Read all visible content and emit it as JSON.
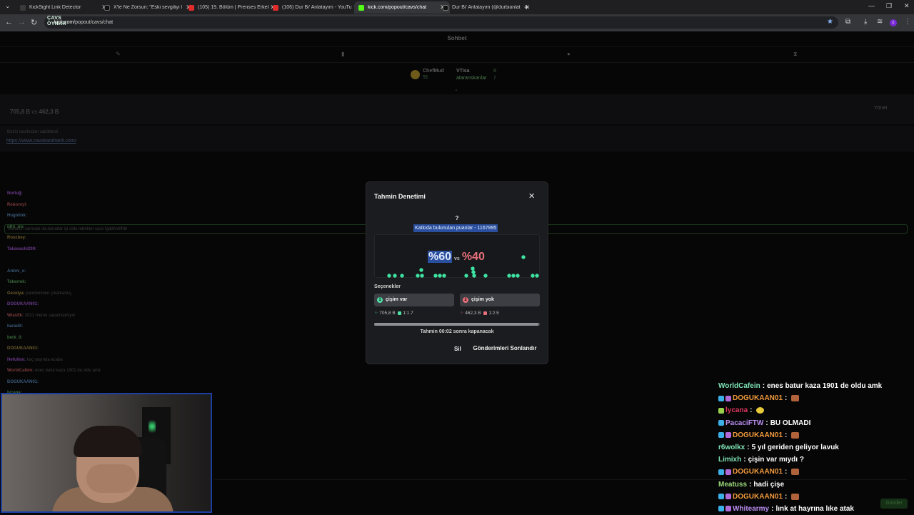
{
  "browser": {
    "tabs": [
      {
        "title": "KickSight Link Detector",
        "color": "#3a3a3a"
      },
      {
        "title": "X'te Ne Zorsun: \"Eski sevgiliyi l",
        "color": "#111111"
      },
      {
        "title": "(105) 19. Bölüm | Prenses Erkek",
        "color": "#e02b2b"
      },
      {
        "title": "(106) Dur Bi' Anlatayım - YouTu",
        "color": "#e02b2b"
      },
      {
        "title": "kick.com/popout/cavs/chat",
        "color": "#53fc18"
      },
      {
        "title": "Dur Bi' Anlatayım (@durbianlat",
        "color": "#111111"
      }
    ],
    "url_host": "kick.com",
    "url_path": "/popout/cavs/chat",
    "profile_initial": "c",
    "overlay_logo": "ÇAVS OYNAR"
  },
  "page": {
    "title": "Sohbet",
    "leaderboard": {
      "first_name": "ChefMud",
      "first_value": "91",
      "second_name": "VTisa",
      "second_value": "8",
      "third_name": "ataranskanlar",
      "third_value": "7"
    },
    "prediction_summary": {
      "left": "705,8 B",
      "vs": "vs",
      "right": "462,3 B",
      "manage": "Yönet"
    },
    "pinned": {
      "by": "Botrix tarafından sabitlendi",
      "link": "https://www.cavskarahanli.com/"
    },
    "left_chat": [
      {
        "user": "Nurtuğ:",
        "text": ""
      },
      {
        "user": "Rebornyl:",
        "text": ""
      },
      {
        "user": "Hugolink:",
        "text": ""
      },
      {
        "user": "nftn_nn:",
        "text": ""
      },
      {
        "user": "Roozbey:",
        "text": ""
      },
      {
        "user": "Takanachi209:",
        "text": ""
      },
      {
        "user": "",
        "text": ""
      },
      {
        "user": "Ardov_x:",
        "text": ""
      },
      {
        "user": "Tekerrek:",
        "text": ""
      },
      {
        "user": "Gezelya:",
        "text": "pandemiden çıkamamış"
      },
      {
        "user": "DOGUKAAN01:",
        "text": ""
      },
      {
        "user": "Wlasfik:",
        "text": "2021 meme sapamiamıyın"
      },
      {
        "user": "haradit:",
        "text": ""
      },
      {
        "user": "berk_0:",
        "text": ""
      },
      {
        "user": "DOGUKAAN01:",
        "text": ""
      },
      {
        "user": "Hefulion:",
        "text": "kaç yaşında acaba"
      },
      {
        "user": "WorldCafein:",
        "text": "enes batur kaza 1901 de oldu amk"
      },
      {
        "user": "DOGUKAAN01:",
        "text": ""
      },
      {
        "user": "lycana:",
        "text": ""
      },
      {
        "user": "PacaciFTW:",
        "text": "BU OLMADI"
      },
      {
        "user": "DOGUKAAN01:",
        "text": ""
      }
    ],
    "highlight_row": "r6wolkx: sarmadı da donatlar iyi oldu tebrikler cavs fgddhshffdh",
    "send_label": "Gönder"
  },
  "overlay_chat": [
    {
      "user": "WorldCafein",
      "color": "#7fe3b5",
      "text": "enes batur kaza 1901 de oldu amk",
      "badges": [],
      "emote": ""
    },
    {
      "user": "DOGUKAAN01",
      "color": "#f29a3c",
      "text": "",
      "badges": [
        "#3bb0e8",
        "#b06ad8"
      ],
      "emote": "brown"
    },
    {
      "user": "lycana",
      "color": "#e0365d",
      "text": "",
      "badges": [
        "#9bd14a"
      ],
      "emote": "yellow"
    },
    {
      "user": "PacaciFTW",
      "color": "#b98df0",
      "text": "BU OLMADI",
      "badges": [
        "#3bb0e8"
      ],
      "emote": ""
    },
    {
      "user": "DOGUKAAN01",
      "color": "#f29a3c",
      "text": "",
      "badges": [
        "#3bb0e8",
        "#b06ad8"
      ],
      "emote": "brown"
    },
    {
      "user": "r6wolkx",
      "color": "#7fe3b5",
      "text": "5 yıl geriden geliyor lavuk",
      "badges": [],
      "emote": ""
    },
    {
      "user": "Limixh",
      "color": "#7fe3b5",
      "text": "çişin var mıydı ?",
      "badges": [],
      "emote": ""
    },
    {
      "user": "DOGUKAAN01",
      "color": "#f29a3c",
      "text": "",
      "badges": [
        "#3bb0e8",
        "#b06ad8"
      ],
      "emote": "brown"
    },
    {
      "user": "Meatuss",
      "color": "#9bd87a",
      "text": "hadi çişe",
      "badges": [],
      "emote": ""
    },
    {
      "user": "DOGUKAAN01",
      "color": "#f29a3c",
      "text": "",
      "badges": [
        "#3bb0e8",
        "#b06ad8"
      ],
      "emote": "brown"
    },
    {
      "user": "Whitearmy",
      "color": "#b98df0",
      "text": "lınk at hayrına lıke atak",
      "badges": [
        "#3bb0e8",
        "#b06ad8"
      ],
      "emote": ""
    }
  ],
  "modal": {
    "title": "Tahmin Denetimi",
    "close": "✕",
    "question": "?",
    "total": "Katkıda bulunulan puanlar - 1167895",
    "pct_left": "%60",
    "vs": "vs",
    "pct_right": "%40",
    "options_label": "Seçenekler",
    "options": [
      {
        "num": "1",
        "label": "çişim var",
        "points": "705,8 B",
        "ratio": "1:1.7",
        "color": "#4fe0a8"
      },
      {
        "num": "2",
        "label": "çişim yok",
        "points": "462,3 B",
        "ratio": "1:2.5",
        "color": "#e8707a"
      }
    ],
    "progress": 0.99,
    "timer": "Tahmin 00:02 sonra kapanacak",
    "delete": "Sil",
    "end": "Gönderimleri Sonlandır"
  },
  "colors": {
    "accent_green": "#53fc18",
    "dot_green": "#3de3a0",
    "pink": "#e8707a",
    "selection": "#2a4f9e"
  }
}
